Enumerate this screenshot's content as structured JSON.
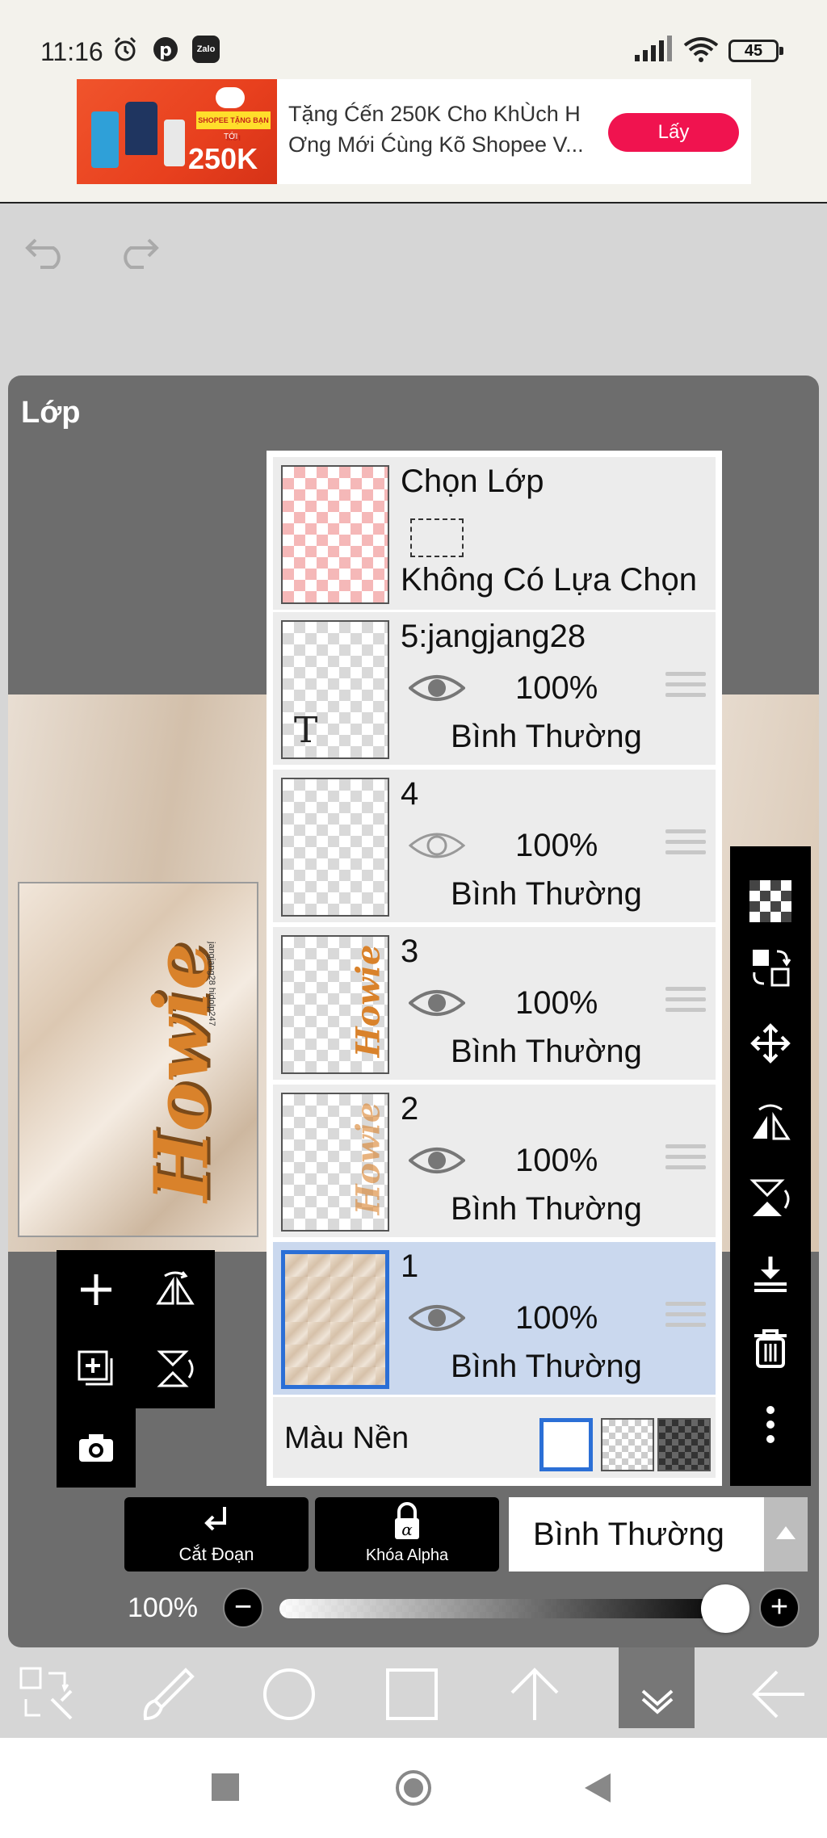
{
  "status_bar": {
    "time": "11:16",
    "battery": "45",
    "icons": [
      "alarm-icon",
      "pinterest-icon",
      "zalo-icon",
      "signal-icon",
      "wifi-icon",
      "battery-icon"
    ],
    "zalo_label": "Zalo"
  },
  "ad": {
    "text": "Tặng Ćến 250K Cho KhÙch H Ơng Mới Ćùng Kõ Shopee V...",
    "button_label": "Lấy",
    "image_amount": "250K",
    "image_tag": "SHOPEE TẶNG BẠN MỚI",
    "image_prefix": "TỚI"
  },
  "panel": {
    "title": "Lớp"
  },
  "preview": {
    "word": "Howie",
    "mini_text": "jangjang28 hidolp247"
  },
  "layers": [
    {
      "name": "Chọn Lớp",
      "subtitle": "Không Có Lựa Chọn",
      "type": "selection"
    },
    {
      "name": "5:jangjang28",
      "opacity": "100%",
      "blend": "Bình Thường",
      "thumb_letter": "T",
      "visible": true
    },
    {
      "name": "4",
      "opacity": "100%",
      "blend": "Bình Thường",
      "visible": false
    },
    {
      "name": "3",
      "opacity": "100%",
      "blend": "Bình Thường",
      "thumb_word": "Howie",
      "visible": true
    },
    {
      "name": "2",
      "opacity": "100%",
      "blend": "Bình Thường",
      "thumb_word": "Howie",
      "visible": true
    },
    {
      "name": "1",
      "opacity": "100%",
      "blend": "Bình Thường",
      "visible": true,
      "selected": true
    }
  ],
  "background": {
    "label": "Màu Nền"
  },
  "bottom_controls": {
    "cut_label": "Cắt Đoạn",
    "alpha_lock_label": "Khóa Alpha",
    "blend_mode": "Bình Thường",
    "opacity_label": "100%",
    "minus": "−",
    "plus": "+",
    "opacity_value": 1.0
  },
  "colors": {
    "selected_row": "#cad8ee",
    "selected_border": "#2b6fd6",
    "ad_button": "#f0134f"
  }
}
